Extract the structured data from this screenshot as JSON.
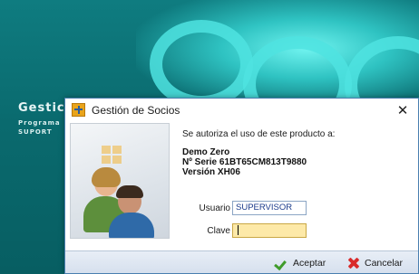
{
  "background": {
    "brand": "Gestic",
    "sub_line1": "Programa",
    "sub_line2": "SUPORT"
  },
  "dialog": {
    "title": "Gestión de Socios",
    "close_symbol": "✕",
    "auth_text": "Se autoriza el uso de este producto a:",
    "licensee": "Demo Zero",
    "serial": "Nº Serie 61BT65CM813T9880",
    "version": "Versión XH06",
    "user_label": "Usuario",
    "user_value": "SUPERVISOR",
    "password_label": "Clave",
    "password_value": "",
    "ok_label": "Aceptar",
    "cancel_label": "Cancelar"
  },
  "colors": {
    "accent": "#0d6e73",
    "ok_icon": "#3f9b2a",
    "cancel_icon": "#d92b2b",
    "password_field_bg": "#fde9a8"
  },
  "icons": [
    "app-icon",
    "close-icon",
    "users-icon",
    "check-icon",
    "cancel-x-icon"
  ]
}
